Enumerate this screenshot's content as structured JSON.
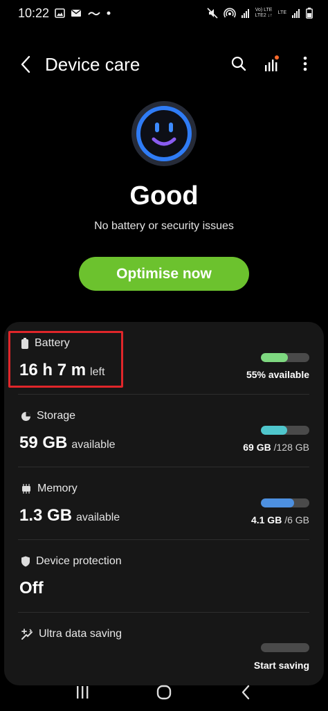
{
  "status_bar": {
    "time": "10:22",
    "net_label_1": "Vo) LTE",
    "net_label_2": "LTE2 ↓↑",
    "net_label_3": "LTE",
    "icons": [
      "gallery-icon",
      "mail-icon",
      "cloud-icon",
      "dot-icon",
      "mute-icon",
      "hotspot-icon",
      "signal-icon",
      "signal-icon",
      "battery-icon"
    ]
  },
  "app_bar": {
    "title": "Device care",
    "back_icon": "chevron-left-icon",
    "actions": [
      "search-icon",
      "stats-icon",
      "more-icon"
    ]
  },
  "hero": {
    "status": "Good",
    "subtitle": "No battery or security issues",
    "button_label": "Optimise now",
    "face_icon": "smiley-icon"
  },
  "items": {
    "battery": {
      "label": "Battery",
      "value": "16 h 7 m",
      "unit": "left",
      "stat": "55% available",
      "fill": 0.55,
      "color": "#7ed880"
    },
    "storage": {
      "label": "Storage",
      "value": "59 GB",
      "unit": "available",
      "stat_main": "69 GB",
      "stat_muted": "/128 GB",
      "fill": 0.54,
      "color": "#4fc6cc"
    },
    "memory": {
      "label": "Memory",
      "value": "1.3 GB",
      "unit": "available",
      "stat_main": "4.1 GB",
      "stat_muted": "/6 GB",
      "fill": 0.68,
      "color": "#4d90e0"
    },
    "protection": {
      "label": "Device protection",
      "value": "Off"
    },
    "data_saving": {
      "label": "Ultra data saving",
      "stat": "Start saving"
    }
  },
  "colors": {
    "accent_green": "#6cc22e",
    "face_blue": "#2f7cf6",
    "face_smile": "#8a5cf0",
    "highlight": "#e0262a"
  },
  "nav": [
    "recents-icon",
    "home-icon",
    "back-icon"
  ]
}
